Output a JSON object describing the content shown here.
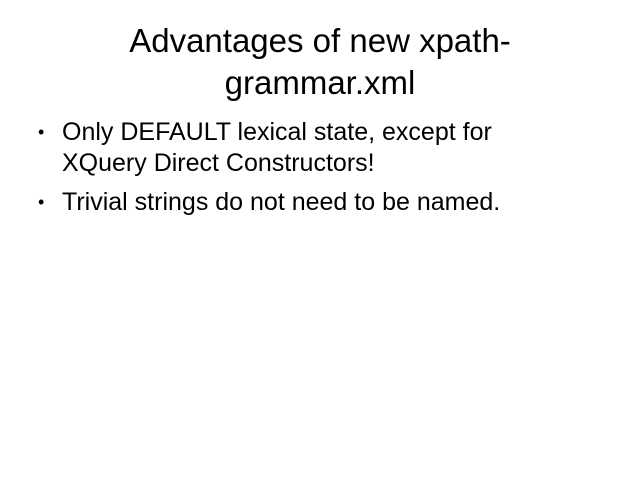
{
  "slide": {
    "title_lines": [
      "Advantages of new xpath-",
      "grammar.xml"
    ],
    "bullet_glyph": "•",
    "bullets": [
      {
        "lines": [
          "Only DEFAULT lexical state, except for",
          "XQuery Direct Constructors!"
        ]
      },
      {
        "lines": [
          "Trivial strings do not need to be named."
        ]
      }
    ]
  }
}
